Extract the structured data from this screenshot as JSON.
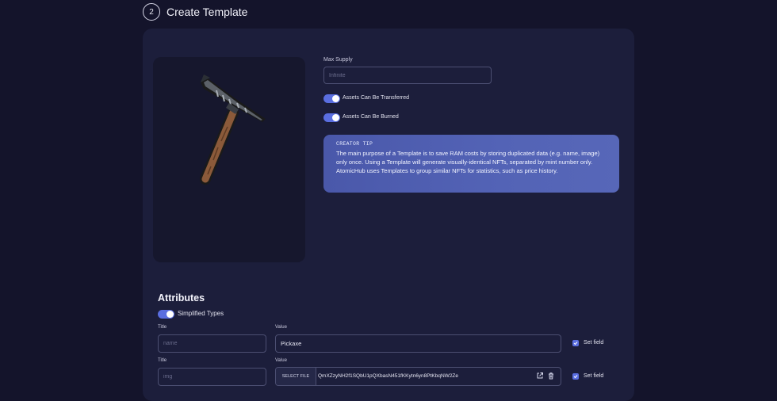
{
  "step": {
    "number": "2",
    "title": "Create Template"
  },
  "max_supply": {
    "label": "Max Supply",
    "placeholder": "Infinite",
    "value": ""
  },
  "toggles": {
    "transferable": {
      "label": "Assets Can Be Transferred",
      "on": true
    },
    "burnable": {
      "label": "Assets Can Be Burned",
      "on": true
    }
  },
  "tip": {
    "title": "CREATOR TIP",
    "text": "The main purpose of a Template is to save RAM costs by storing duplicated data (e.g. name, image) only once. Using a Template will generate visually-identical NFTs, separated by mint number only. AtomicHub uses Templates to group similar NFTs for statistics, such as price history."
  },
  "preview": {
    "image": "pickaxe"
  },
  "attributes": {
    "heading": "Attributes",
    "simplified_types": {
      "label": "Simplified Types",
      "on": true
    },
    "rows": [
      {
        "title_label": "Title",
        "title_placeholder": "name",
        "value_label": "Value",
        "value": "Pickaxe",
        "set_field_label": "Set field",
        "set_field": true
      },
      {
        "title_label": "Title",
        "title_placeholder": "img",
        "value_label": "Value",
        "select_file_label": "SELECT FILE",
        "value": "QmXZzyNH2f1SQbU1pQXbasN451fKKytn6yn8PtKbqNW2Ze",
        "set_field_label": "Set field",
        "set_field": true
      }
    ]
  },
  "colors": {
    "accent": "#5a6ee0",
    "card": "#1c1e3b",
    "background": "#14142b",
    "tip": "#5060b0"
  }
}
